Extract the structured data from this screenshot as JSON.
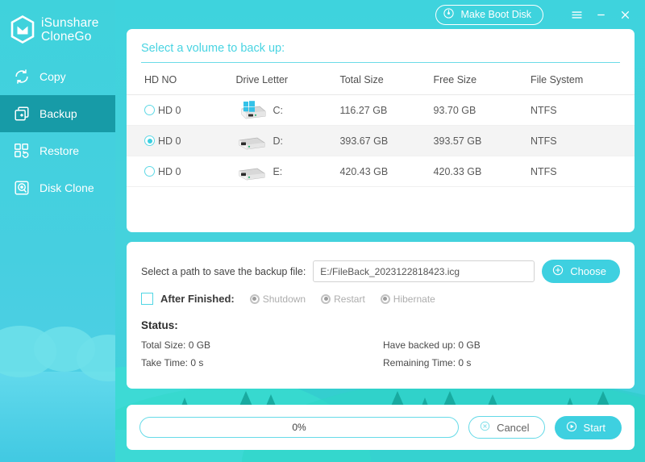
{
  "app": {
    "brand_line1": "iSunshare",
    "brand_line2": "CloneGo",
    "logo_icon": "shield-logo-icon"
  },
  "titlebar": {
    "boot_disk_label": "Make Boot Disk",
    "boot_disk_icon": "disc-icon",
    "menu_icon": "hamburger-menu-icon",
    "minimize_icon": "minimize-icon",
    "close_icon": "close-icon"
  },
  "sidebar": {
    "items": [
      {
        "label": "Copy",
        "icon": "refresh-cycle-icon",
        "active": false
      },
      {
        "label": "Backup",
        "icon": "copy-plus-icon",
        "active": true
      },
      {
        "label": "Restore",
        "icon": "restore-blocks-icon",
        "active": false
      },
      {
        "label": "Disk Clone",
        "icon": "hard-disk-icon",
        "active": false
      }
    ]
  },
  "volumes_panel": {
    "title": "Select a volume to back up:",
    "columns": [
      "HD NO",
      "Drive Letter",
      "Total Size",
      "Free Size",
      "File System"
    ],
    "rows": [
      {
        "hd_no": "HD 0",
        "drive_letter": "C:",
        "total_size": "116.27 GB",
        "free_size": "93.70 GB",
        "file_system": "NTFS",
        "selected": false,
        "icon": "windows-drive-icon"
      },
      {
        "hd_no": "HD 0",
        "drive_letter": "D:",
        "total_size": "393.67 GB",
        "free_size": "393.57 GB",
        "file_system": "NTFS",
        "selected": true,
        "icon": "hard-drive-icon"
      },
      {
        "hd_no": "HD 0",
        "drive_letter": "E:",
        "total_size": "420.43 GB",
        "free_size": "420.33 GB",
        "file_system": "NTFS",
        "selected": false,
        "icon": "hard-drive-icon"
      }
    ]
  },
  "settings_panel": {
    "path_label": "Select a path to save the backup file:",
    "path_value": "E:/FileBack_2023122818423.icg",
    "path_placeholder": "E:/FileBack_2023122818423.icg",
    "choose_label": "Choose",
    "choose_icon": "plus-circle-icon",
    "after_finished_label": "After Finished:",
    "after_finished_checked": false,
    "after_finished_options": [
      {
        "label": "Shutdown",
        "enabled": false
      },
      {
        "label": "Restart",
        "enabled": false
      },
      {
        "label": "Hibernate",
        "enabled": false
      }
    ],
    "status_title": "Status:",
    "status_items": [
      {
        "label": "Total Size: 0 GB"
      },
      {
        "label": "Have backed up: 0 GB"
      },
      {
        "label": "Take Time: 0 s"
      },
      {
        "label": "Remaining Time: 0 s"
      }
    ]
  },
  "footer": {
    "progress_text": "0%",
    "progress_percent": 0,
    "cancel_label": "Cancel",
    "cancel_icon": "x-circle-icon",
    "start_label": "Start",
    "start_icon": "play-circle-icon"
  },
  "colors": {
    "brand_teal": "#3ed0e0",
    "sidebar_active": "#179ba7",
    "title_text": "#49d4e2",
    "accent_border": "#67dbe8"
  }
}
